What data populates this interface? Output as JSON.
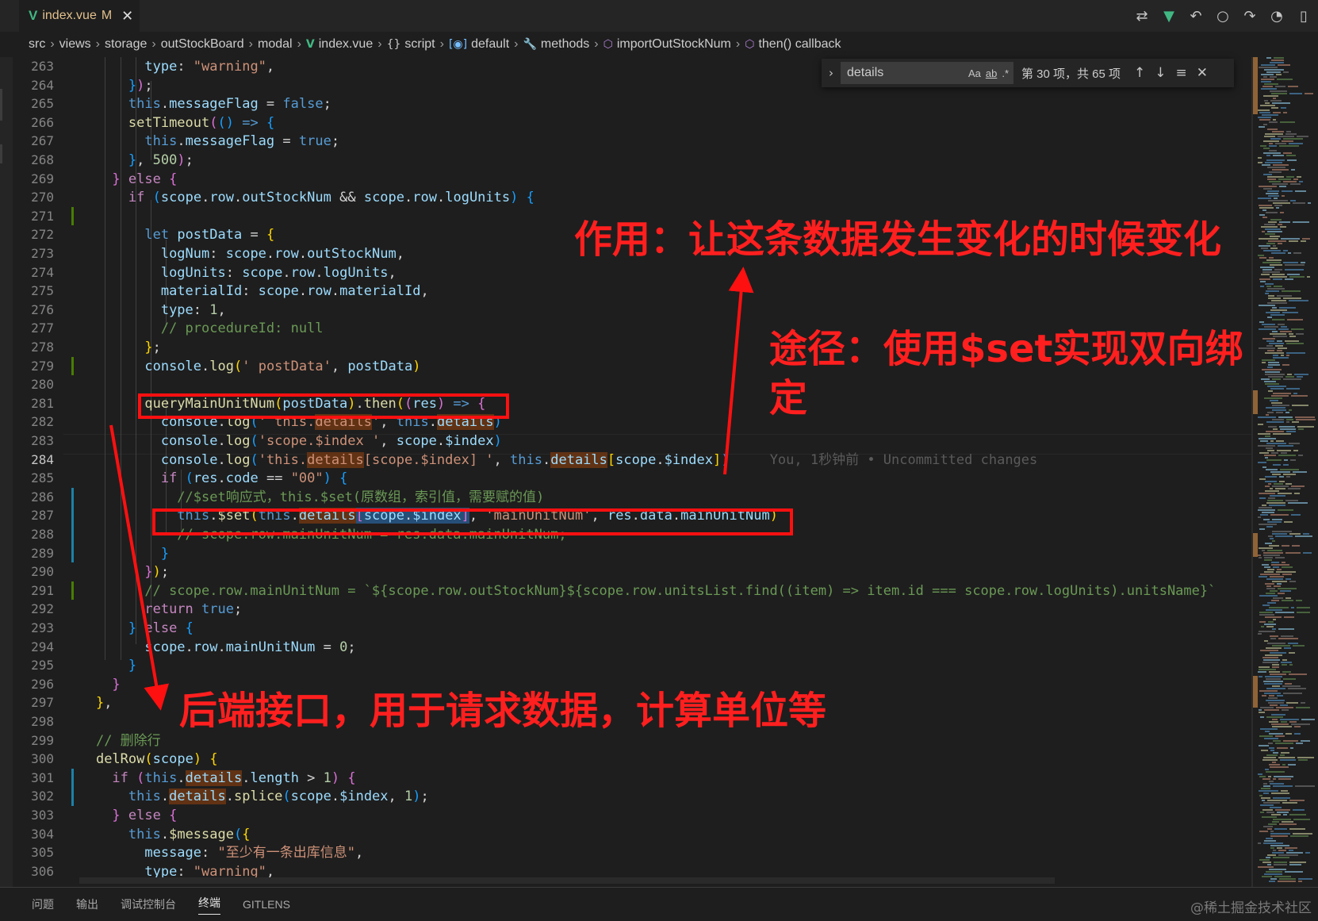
{
  "tab": {
    "icon": "vue-icon",
    "filename": "index.vue",
    "status": "M",
    "close_glyph": "✕"
  },
  "toolbar_icons": [
    "compare-icon",
    "vue-devtools-icon",
    "go-back-icon",
    "circle-icon",
    "go-forward-icon",
    "gitlens-icon",
    "split-editor-icon"
  ],
  "breadcrumb": [
    {
      "label": "src",
      "icon": ""
    },
    {
      "label": "views",
      "icon": ""
    },
    {
      "label": "storage",
      "icon": ""
    },
    {
      "label": "outStockBoard",
      "icon": ""
    },
    {
      "label": "modal",
      "icon": ""
    },
    {
      "label": "index.vue",
      "icon": "vue-icon"
    },
    {
      "label": "script",
      "icon": "braces-icon"
    },
    {
      "label": "default",
      "icon": "module-icon"
    },
    {
      "label": "methods",
      "icon": "wrench-icon"
    },
    {
      "label": "importOutStockNum",
      "icon": "cube-icon"
    },
    {
      "label": "then() callback",
      "icon": "cube-icon"
    }
  ],
  "find_widget": {
    "value": "details",
    "opt_case": "Aa",
    "opt_word": "ab",
    "opt_regex": ".*",
    "count": "第 30 项，共 65 项"
  },
  "line_numbers": [
    "263",
    "264",
    "265",
    "266",
    "267",
    "268",
    "269",
    "270",
    "271",
    "272",
    "273",
    "274",
    "275",
    "276",
    "277",
    "278",
    "279",
    "280",
    "281",
    "282",
    "283",
    "284",
    "285",
    "286",
    "287",
    "288",
    "289",
    "290",
    "291",
    "292",
    "293",
    "294",
    "295",
    "296",
    "297",
    "298",
    "299",
    "300",
    "301",
    "302",
    "303",
    "304",
    "305",
    "306"
  ],
  "current_line": "284",
  "blame": "You, 1秒钟前 • Uncommitted changes",
  "annotations": {
    "purpose": "作用：让这条数据发生变化的时候变化",
    "method_line1": "途径：使用$set实现双向绑",
    "method_line2": "定",
    "backend": "后端接口，用于请求数据，计算单位等"
  },
  "bottom_panel": {
    "tabs": [
      "问题",
      "输出",
      "调试控制台",
      "终端",
      "GITLENS"
    ],
    "active": "终端"
  },
  "watermark": "@稀土掘金技术社区",
  "colors": {
    "annotation_red": "#ff1f1f",
    "keyword": "#569cd6",
    "string": "#ce9178",
    "variable": "#9cdcfe",
    "function": "#dcdcaa",
    "comment": "#6a9955"
  }
}
